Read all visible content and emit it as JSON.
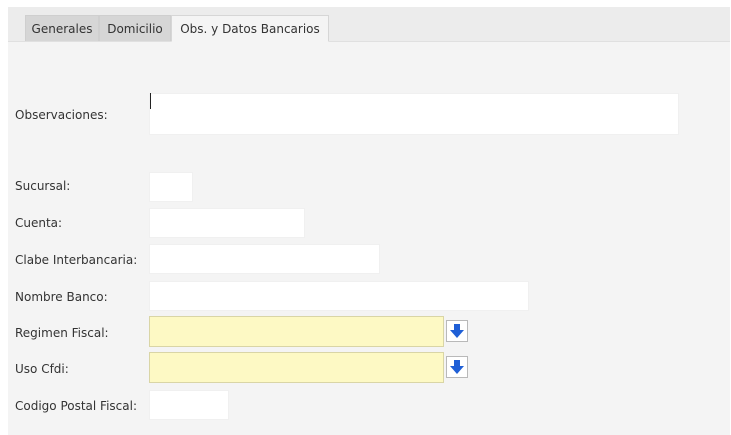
{
  "tabs": [
    {
      "label": "Generales"
    },
    {
      "label": "Domicilio"
    },
    {
      "label": "Obs. y Datos Bancarios"
    }
  ],
  "form": {
    "observaciones": {
      "label": "Observaciones:",
      "value": ""
    },
    "sucursal": {
      "label": "Sucursal:",
      "value": ""
    },
    "cuenta": {
      "label": "Cuenta:",
      "value": ""
    },
    "clabe": {
      "label": "Clabe Interbancaria:",
      "value": ""
    },
    "nombre_banco": {
      "label": "Nombre Banco:",
      "value": ""
    },
    "regimen_fiscal": {
      "label": "Regimen Fiscal:",
      "value": ""
    },
    "uso_cfdi": {
      "label": "Uso Cfdi:",
      "value": ""
    },
    "codigo_postal_fiscal": {
      "label": "Codigo Postal Fiscal:",
      "value": ""
    }
  },
  "colors": {
    "lookup_field_bg": "#fdf9c4",
    "lookup_arrow": "#1f5fd6"
  },
  "icons": {
    "lookup": "arrow-down-icon"
  }
}
